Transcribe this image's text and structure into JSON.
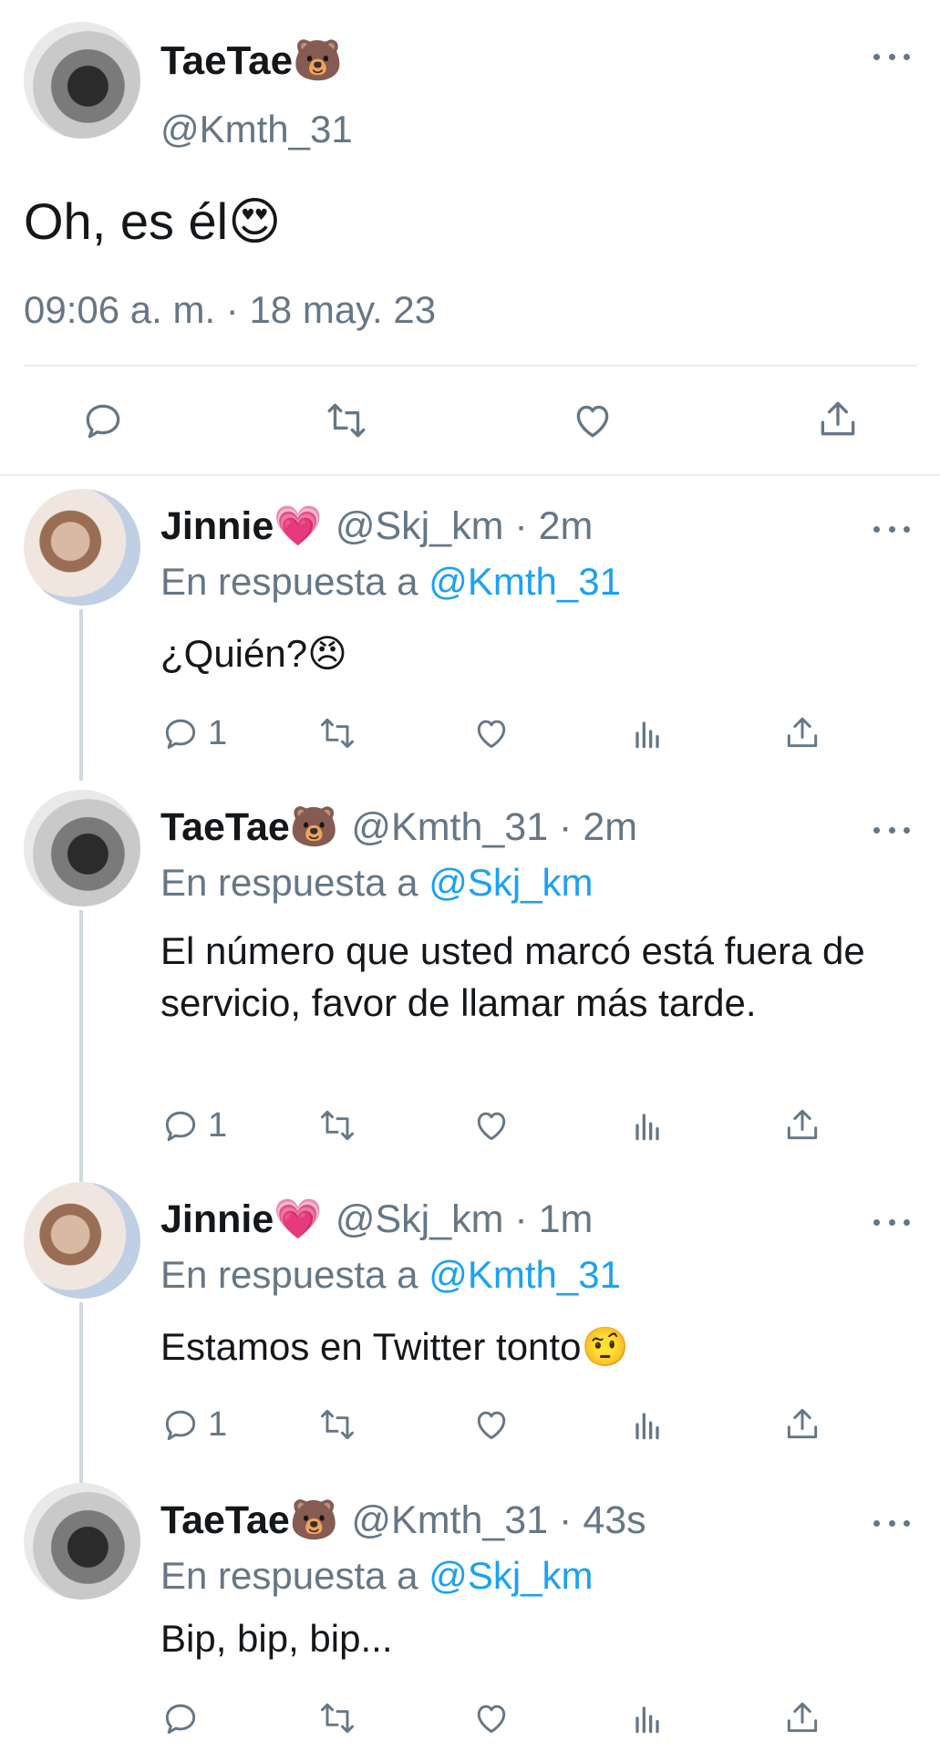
{
  "main_tweet": {
    "name": "TaeTae",
    "name_emoji": "🐻",
    "handle": "@Kmth_31",
    "text": "Oh, es él",
    "text_emoji": "😍",
    "timestamp": "09:06 a. m. · 18 may. 23"
  },
  "replies": [
    {
      "name": "Jinnie",
      "name_emoji": "💗",
      "handle_time": "@Skj_km · 2m",
      "in_reply_label": "En respuesta a",
      "mention": "@Kmth_31",
      "text": "¿Quién?",
      "text_emoji": "😠",
      "reply_count": "1"
    },
    {
      "name": "TaeTae",
      "name_emoji": "🐻",
      "handle_time": "@Kmth_31 · 2m",
      "in_reply_label": "En respuesta a",
      "mention": "@Skj_km",
      "text": "El número que usted marcó está fuera de servicio, favor de llamar más tarde.",
      "text_emoji": "",
      "reply_count": "1"
    },
    {
      "name": "Jinnie",
      "name_emoji": "💗",
      "handle_time": "@Skj_km · 1m",
      "in_reply_label": "En respuesta a",
      "mention": "@Kmth_31",
      "text": "Estamos en Twitter tonto",
      "text_emoji": "🤨",
      "reply_count": "1"
    },
    {
      "name": "TaeTae",
      "name_emoji": "🐻",
      "handle_time": "@Kmth_31 · 43s",
      "in_reply_label": "En respuesta a",
      "mention": "@Skj_km",
      "text": "Bip, bip, bip...",
      "text_emoji": "",
      "reply_count": ""
    }
  ],
  "icons": [
    "reply-icon",
    "retweet-icon",
    "like-icon",
    "share-icon",
    "analytics-icon",
    "more-icon"
  ],
  "colors": {
    "link": "#1da1f2",
    "secondary": "#657786",
    "text": "#14171a",
    "divider": "#e6ecf0"
  }
}
